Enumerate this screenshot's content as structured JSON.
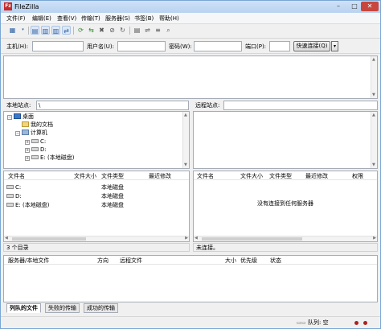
{
  "window": {
    "title": "FileZilla",
    "app_icon": "Fz"
  },
  "menu": [
    "文件(F)",
    "编辑(E)",
    "查看(V)",
    "传输(T)",
    "服务器(S)",
    "书签(B)",
    "帮助(H)"
  ],
  "quickconnect": {
    "host_label": "主机(H):",
    "user_label": "用户名(U):",
    "pass_label": "密码(W):",
    "port_label": "端口(P):",
    "host_value": "",
    "user_value": "",
    "pass_value": "",
    "port_value": "",
    "button": "快速连接(Q)",
    "dropdown": "▾"
  },
  "local": {
    "site_label": "本地站点:",
    "path": "\\",
    "tree": [
      {
        "label": "桌面",
        "icon": "desktop-icon",
        "expander": "−"
      },
      {
        "label": "我的文档",
        "icon": "folder-icon",
        "expander": ""
      },
      {
        "label": "计算机",
        "icon": "computer-icon",
        "expander": "−"
      },
      {
        "label": "C:",
        "icon": "drive-icon",
        "expander": "+"
      },
      {
        "label": "D:",
        "icon": "drive-icon",
        "expander": "+"
      },
      {
        "label": "E: (本地磁盘)",
        "icon": "drive-icon",
        "expander": "+"
      }
    ],
    "columns": [
      "文件名",
      "文件大小",
      "文件类型",
      "最近修改"
    ],
    "files": [
      {
        "name": "C:",
        "size": "",
        "type": "本地磁盘",
        "modified": ""
      },
      {
        "name": "D:",
        "size": "",
        "type": "本地磁盘",
        "modified": ""
      },
      {
        "name": "E: (本地磁盘)",
        "size": "",
        "type": "本地磁盘",
        "modified": ""
      }
    ],
    "status": "3 个目录"
  },
  "remote": {
    "site_label": "远程站点:",
    "path": "",
    "columns": [
      "文件名",
      "文件大小",
      "文件类型",
      "最近修改",
      "权限"
    ],
    "empty_message": "没有连接到任何服务器",
    "status": "未连接。"
  },
  "queue": {
    "columns": [
      "服务器/本地文件",
      "方向",
      "远程文件",
      "大小",
      "优先级",
      "状态"
    ]
  },
  "tabs": [
    "列队的文件",
    "失败的传输",
    "成功的传输"
  ],
  "statusbar": {
    "queue": "队列: 空"
  }
}
